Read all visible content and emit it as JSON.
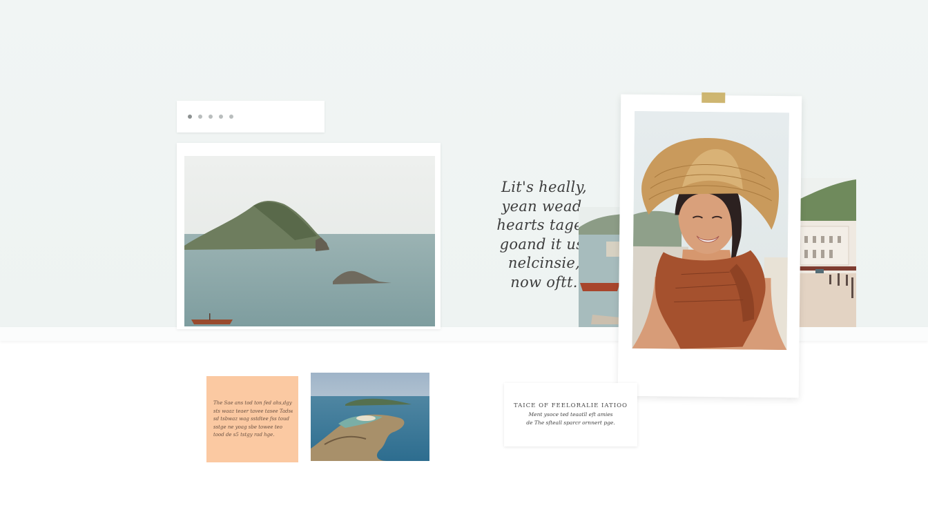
{
  "slider": {
    "dot_count": 5,
    "active_index": 0
  },
  "quote": {
    "lines": [
      "Lit's heally,",
      "yean wead,",
      "hearts tagee",
      "goand it us,",
      "nelcinsie,",
      "now oftt."
    ]
  },
  "note": {
    "lines": [
      "The Sae ans tod ton fed ahs,dgy",
      "sts waaz teaer tavee tasee Tadse",
      "sd tsbwaz wag sstdtee fss toud",
      "sstge ne yoag sbe towee teo",
      "tood de s5 tstgy rad hge."
    ]
  },
  "caption": {
    "title": "TAICE OF FEELORALIE IATIOO",
    "lines": [
      "Ment ysoce ted teaatll eft amies",
      "de The sfteall sparcr ornnert pge."
    ]
  },
  "icons": {
    "island_photo": "island-photo",
    "portrait_photo": "woman-straw-hat-photo",
    "aerial_photo": "aerial-island-photo"
  },
  "colors": {
    "accent_peach": "#fbc9a2",
    "tape": "#c9ae62",
    "scarf": "#a5512e"
  }
}
